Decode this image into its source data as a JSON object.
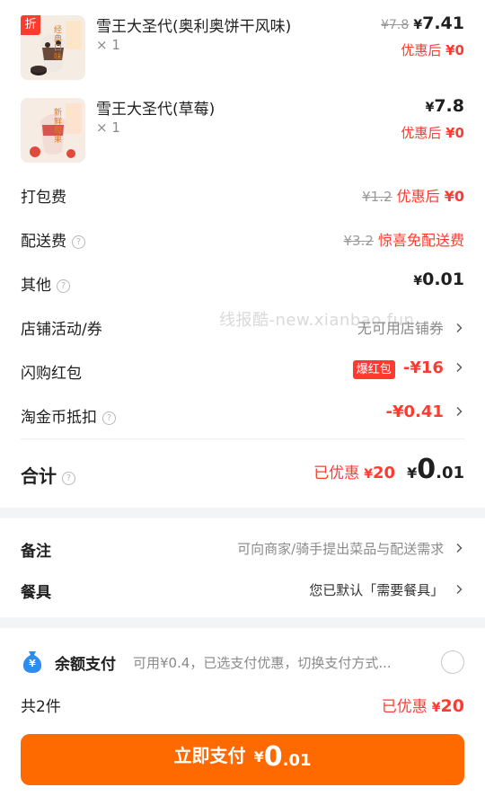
{
  "items": [
    {
      "name": "雪王大圣代(奥利奥饼干风味)",
      "qty": "× 1",
      "badge": "折",
      "thumb_text": "经典口味",
      "orig_price": "¥7.8",
      "price_yen": "¥",
      "price": "7.41",
      "after_label": "优惠后",
      "after_value": "¥0"
    },
    {
      "name": "雪王大圣代(草莓)",
      "qty": "× 1",
      "thumb_text": "新鲜莓果",
      "price_yen": "¥",
      "price": "7.8",
      "after_label": "优惠后",
      "after_value": "¥0"
    }
  ],
  "fees": {
    "packing": {
      "label": "打包费",
      "orig": "¥1.2",
      "after_label": "优惠后",
      "after_value": "¥0"
    },
    "delivery": {
      "label": "配送费",
      "orig": "¥3.2",
      "promo": "惊喜免配送费"
    },
    "other": {
      "label": "其他",
      "yen": "¥",
      "value": "0.01"
    },
    "store_coupon": {
      "label": "店铺活动/券",
      "value": "无可用店铺券"
    },
    "flash_red": {
      "label": "闪购红包",
      "badge": "爆红包",
      "value": "-¥16"
    },
    "taojin": {
      "label": "淘金币抵扣",
      "value": "-¥0.41"
    }
  },
  "total": {
    "label": "合计",
    "saved_label": "已优惠",
    "saved_yen": "¥",
    "saved_value": "20",
    "yen": "¥",
    "int": "0",
    "dec": ".01"
  },
  "notes": {
    "remark_label": "备注",
    "remark_value": "可向商家/骑手提出菜品与配送需求",
    "cutlery_label": "餐具",
    "cutlery_value": "您已默认「需要餐具」"
  },
  "payment": {
    "method_label": "余额支付",
    "method_desc": "可用¥0.4，已选支付优惠，切换支付方式...",
    "icon_symbol": "¥"
  },
  "footer": {
    "count": "共2件",
    "saved_label": "已优惠",
    "saved_yen": "¥",
    "saved_value": "20"
  },
  "pay_button": {
    "label": "立即支付",
    "yen": "¥",
    "int": "0",
    "dec": ".01"
  },
  "watermark": "线报酷-new.xianbao.fun",
  "colors": {
    "accent": "#ff6a00",
    "red": "#ff3b30",
    "muted": "#8a8a8a",
    "pay_icon": "#2d8cf0"
  },
  "icons": [
    "chevron-right-icon",
    "help-icon",
    "money-bag-icon",
    "radio-icon"
  ]
}
